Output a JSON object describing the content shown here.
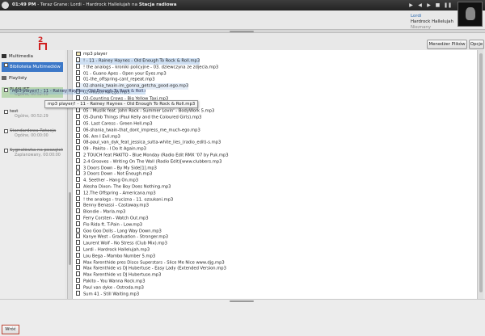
{
  "topbar": {
    "time": "01:49 PM",
    "prefix": " - Teraz Grane: ",
    "now_playing": "Lordi - Hardrock Hallelujah na ",
    "station": "Stacja radiowa",
    "controls": [
      "play-icon",
      "previous-icon",
      "next-icon",
      "stop-icon",
      "pause-icon",
      "volume-icon"
    ]
  },
  "now_playing_panel": {
    "artist": "Lordi",
    "title": "Hardrock Hallelujah",
    "status": "Nieznany"
  },
  "toolbar": {
    "file_manager_label": "Menedżer Plików",
    "options_label": "Opcje"
  },
  "sidebar": {
    "multimedia_label": "Multimedia",
    "library_label": "Biblioteka Multimediów",
    "playlists_label": "Playlisty",
    "playlists": [
      {
        "name": "PLAYLIST",
        "sub": "Ogólne, 00:52:59"
      },
      {
        "name": "test",
        "sub": "Ogólne, 00:52:29"
      },
      {
        "name": "Standardowa Rotacja",
        "sub": "Ogólne, 00:00:00"
      },
      {
        "name": "Sygnałówka na początek",
        "sub": "Zaplanowany, 00:00:00"
      }
    ]
  },
  "drag": {
    "ghost_text": "mp3 player/! - 11 - Rainey Haynes - Old Enough To Rock & Roll.mp3",
    "tooltip": "mp3 player/! - 11 - Rainey Haynes - Old Enough To Rock & Roll.mp3"
  },
  "annotation": {
    "number": "2"
  },
  "files": {
    "folder": "mp3 player",
    "items": [
      "! - 11 - Rainey Haynes - Old Enough To Rock & Roll.mp3",
      "! the analogs - kroniki policyjne - 03. dziewczyna ze zdjecia.mp3",
      "01 - Guano Apes - Open your Eyes.mp3",
      "01-the_offspring-cant_repeat.mp3",
      "02-shania_twain-im_gonna_getcha_good-ego.mp3",
      "02-Miasto Księga.mp3",
      "03-Counting Crows - Big Yellow Taxi.mp3",
      "04-the_offspring-one_fine_day.mp3",
      "05 - Muslik feat. John Rock - Summer Lovin' - BodyWork 5.mp3",
      "05-Dumb Things (Paul Kelly and the Coloured Girls).mp3",
      "05. Last Caress - Green Hell.mp3",
      "06-shania_twain-that_dont_impress_me_much-ego.mp3",
      "06. Am I Evil.mp3",
      "08-paul_van_dyk_feat_jessica_sutta-white_lies_(radio_edit)-s.mp3",
      "09 - Pakito - I Do It Again.mp3",
      "2 TOUCH feat PAKITO - Blue Monday (Radio Edit RMX '07 by Puk.mp3",
      "2-4 Grooves - Writing On The Wall (Radio Edit)[www.clubbers.mp3",
      "3 Doors Down - By My Side[1].mp3",
      "3 Doors Down - Not Enough.mp3",
      "4. Seether - Hang On.mp3",
      "Alesha Dixon- The Boy Does Nothing.mp3",
      "12.The Offspring - Americana.mp3",
      "! the analogs - truciznа - 11. ozsukani.mp3",
      "Benny Benassi - Castaway.mp3",
      "Blondie - Maria.mp3",
      "Ferry Corsten - Watch Out.mp3",
      "Flo Rida ft. T-Pain - Low.mp3",
      "Goo Goo Dolls - Long Way Down.mp3",
      "Kanye West - Graduation - Stronger.mp3",
      "Laurent Wolf - No Stress (Club Mix).mp3",
      "Lordi - Hardrock Hallelujah.mp3",
      "Lou Bega - Mambo Number 5.mp3",
      "Max Farenthide pres Disco Superstars - Slice Me Nice www.djg.mp3",
      "Max Farenthide vs DJ Hubertuse - Easy Lady (Extended Version.mp3",
      "Max Farenthide vs DJ Hubertuse.mp3",
      "Pakito - You Wanna Rock.mp3",
      "Paul van dyke - Ostroda.mp3",
      "Sum 41 - Still Waiting.mp3"
    ]
  },
  "footer": {
    "back_label": "Wróć"
  },
  "colors": {
    "topbar": "#2c2c2c",
    "selection": "#3c78c8",
    "annotation": "#d02020"
  }
}
